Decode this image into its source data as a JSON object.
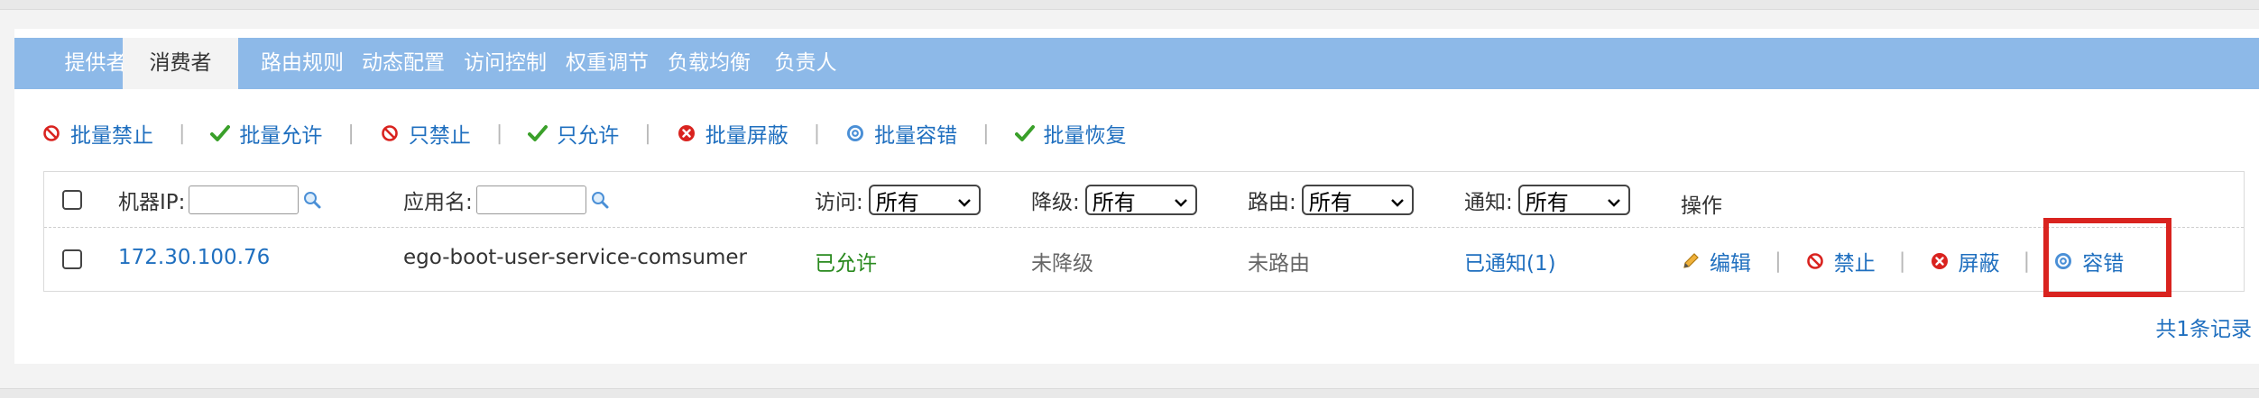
{
  "tabs": [
    {
      "label": "提供者",
      "active": false
    },
    {
      "label": "消费者",
      "active": true
    },
    {
      "label": "路由规则",
      "active": false
    },
    {
      "label": "动态配置",
      "active": false
    },
    {
      "label": "访问控制",
      "active": false
    },
    {
      "label": "权重调节",
      "active": false
    },
    {
      "label": "负载均衡",
      "active": false
    },
    {
      "label": "负责人",
      "active": false
    }
  ],
  "toolbar": {
    "batch_disable": "批量禁止",
    "batch_allow": "批量允许",
    "only_disable": "只禁止",
    "only_allow": "只允许",
    "batch_shield": "批量屏蔽",
    "batch_tolerance": "批量容错",
    "batch_recover": "批量恢复",
    "separator": "|"
  },
  "table": {
    "headers": {
      "ip_label": "机器IP:",
      "app_label": "应用名:",
      "access_label": "访问:",
      "access_value": "所有",
      "degrade_label": "降级:",
      "degrade_value": "所有",
      "route_label": "路由:",
      "route_value": "所有",
      "notify_label": "通知:",
      "notify_value": "所有",
      "actions_label": "操作"
    },
    "rows": [
      {
        "ip": "172.30.100.76",
        "app": "ego-boot-user-service-comsumer",
        "access": "已允许",
        "degrade": "未降级",
        "route": "未路由",
        "notify": "已通知(1)",
        "actions": {
          "edit": "编辑",
          "disable": "禁止",
          "shield": "屏蔽",
          "tolerance": "容错"
        }
      }
    ]
  },
  "footer": {
    "total": "共1条记录"
  },
  "colors": {
    "tab_bar": "#8db9e8",
    "link": "#1f6fbf",
    "allowed": "#2a8a1f",
    "highlight": "#d9231f"
  }
}
